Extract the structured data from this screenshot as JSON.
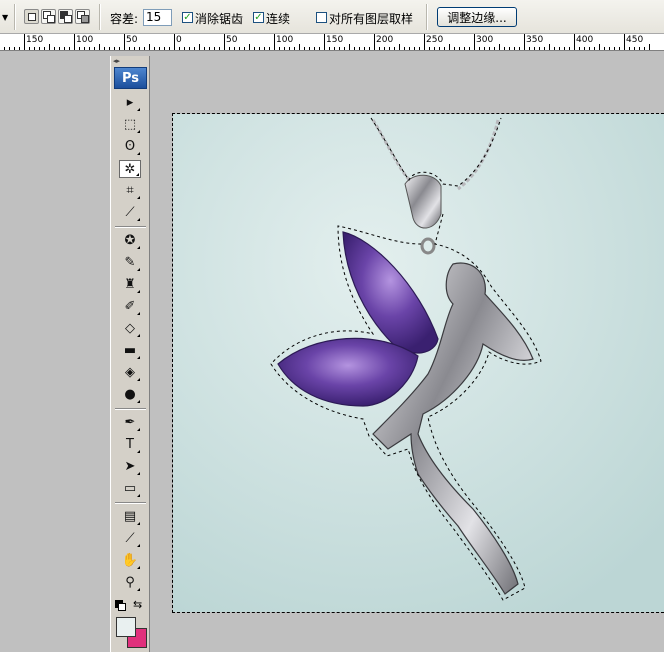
{
  "options_bar": {
    "tolerance_label": "容差:",
    "tolerance_value": "15",
    "anti_alias_label": "消除锯齿",
    "anti_alias_checked": true,
    "contiguous_label": "连续",
    "contiguous_checked": true,
    "sample_all_layers_label": "对所有图层取样",
    "sample_all_layers_checked": false,
    "refine_edge_label": "调整边缘..."
  },
  "ruler": {
    "labels": [
      "150",
      "100",
      "50",
      "0",
      "50",
      "100",
      "150",
      "200",
      "250",
      "300",
      "350",
      "400",
      "450"
    ]
  },
  "toolbox": {
    "logo": "Ps",
    "tools": [
      {
        "name": "move-tool",
        "icon": "move-icon",
        "glyph": "▸"
      },
      {
        "name": "marquee-tool",
        "icon": "rect-marquee-icon",
        "glyph": "⬚"
      },
      {
        "name": "lasso-tool",
        "icon": "lasso-icon",
        "glyph": "ʘ"
      },
      {
        "name": "magic-wand-tool",
        "icon": "magic-wand-icon",
        "glyph": "✲",
        "active": true
      },
      {
        "name": "crop-tool",
        "icon": "crop-icon",
        "glyph": "⌗"
      },
      {
        "name": "slice-tool",
        "icon": "slice-icon",
        "glyph": "⟋"
      },
      {
        "name": "healing-brush-tool",
        "icon": "healing-brush-icon",
        "glyph": "✪"
      },
      {
        "name": "brush-tool",
        "icon": "brush-icon",
        "glyph": "✎"
      },
      {
        "name": "clone-stamp-tool",
        "icon": "stamp-icon",
        "glyph": "♜"
      },
      {
        "name": "history-brush-tool",
        "icon": "history-brush-icon",
        "glyph": "✐"
      },
      {
        "name": "eraser-tool",
        "icon": "eraser-icon",
        "glyph": "◇"
      },
      {
        "name": "gradient-tool",
        "icon": "gradient-icon",
        "glyph": "▬"
      },
      {
        "name": "blur-tool",
        "icon": "blur-drop-icon",
        "glyph": "◈"
      },
      {
        "name": "dodge-tool",
        "icon": "dodge-icon",
        "glyph": "●"
      },
      {
        "name": "pen-tool",
        "icon": "pen-icon",
        "glyph": "✒"
      },
      {
        "name": "type-tool",
        "icon": "type-icon",
        "glyph": "T"
      },
      {
        "name": "path-selection-tool",
        "icon": "path-select-icon",
        "glyph": "➤"
      },
      {
        "name": "shape-tool",
        "icon": "rectangle-shape-icon",
        "glyph": "▭"
      },
      {
        "name": "notes-tool",
        "icon": "notes-icon",
        "glyph": "▤"
      },
      {
        "name": "eyedropper-tool",
        "icon": "eyedropper-icon",
        "glyph": "⟋"
      },
      {
        "name": "hand-tool",
        "icon": "hand-icon",
        "glyph": "✋"
      },
      {
        "name": "zoom-tool",
        "icon": "zoom-icon",
        "glyph": "⚲"
      }
    ],
    "foreground_color": "#e9f0f0",
    "background_color": "#e0307c"
  },
  "canvas": {
    "background_color": "#d4e6e5",
    "gem_color": "#5a3a96",
    "metal_color": "#c8c8cc"
  }
}
